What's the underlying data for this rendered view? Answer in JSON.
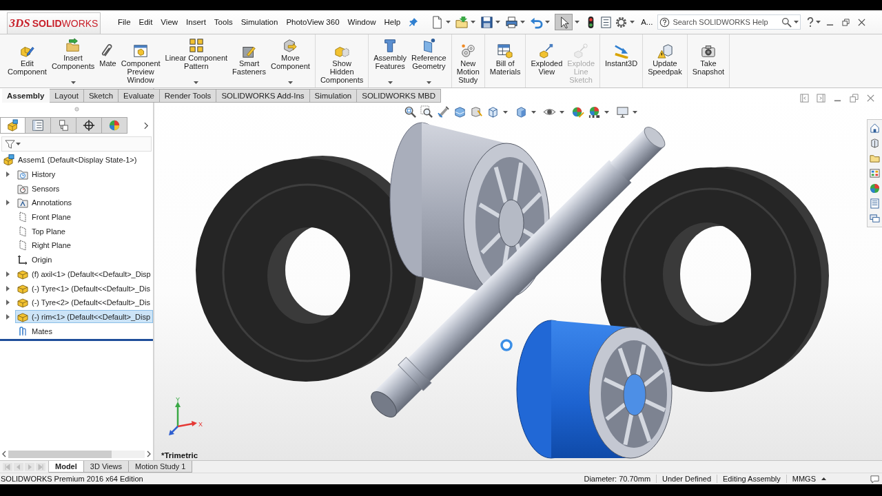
{
  "title_bar": {
    "logo_mark": "3DS",
    "logo": "**SOLID**WORKS",
    "menu": [
      "File",
      "Edit",
      "View",
      "Insert",
      "Tools",
      "Simulation",
      "PhotoView 360",
      "Window",
      "Help"
    ],
    "select_tool": {
      "selected": true
    },
    "overflow": "A...",
    "search": {
      "placeholder": "Search SOLIDWORKS Help"
    }
  },
  "ribbon": {
    "groups": [
      [
        {
          "label": "Edit\nComponent",
          "dropdown": false,
          "disabled": false
        },
        {
          "label": "Insert\nComponents",
          "dropdown": true,
          "disabled": false
        },
        {
          "label": "Mate",
          "dropdown": false,
          "disabled": false
        },
        {
          "label": "Component\nPreview\nWindow",
          "dropdown": false,
          "disabled": false
        },
        {
          "label": "Linear Component\nPattern",
          "dropdown": true,
          "disabled": false
        },
        {
          "label": "Smart\nFasteners",
          "dropdown": false,
          "disabled": false
        },
        {
          "label": "Move\nComponent",
          "dropdown": true,
          "disabled": false
        }
      ],
      [
        {
          "label": "Show\nHidden\nComponents",
          "dropdown": false,
          "disabled": false
        }
      ],
      [
        {
          "label": "Assembly\nFeatures",
          "dropdown": true,
          "disabled": false
        },
        {
          "label": "Reference\nGeometry",
          "dropdown": true,
          "disabled": false
        }
      ],
      [
        {
          "label": "New\nMotion\nStudy",
          "dropdown": false,
          "disabled": false
        }
      ],
      [
        {
          "label": "Bill of\nMaterials",
          "dropdown": false,
          "disabled": false
        }
      ],
      [
        {
          "label": "Exploded\nView",
          "dropdown": false,
          "disabled": false
        },
        {
          "label": "Explode\nLine\nSketch",
          "dropdown": false,
          "disabled": true
        }
      ],
      [
        {
          "label": "Instant3D",
          "dropdown": false,
          "disabled": false
        }
      ],
      [
        {
          "label": "Update\nSpeedpak",
          "dropdown": false,
          "disabled": false
        }
      ],
      [
        {
          "label": "Take\nSnapshot",
          "dropdown": false,
          "disabled": false
        }
      ]
    ]
  },
  "command_tabs": [
    {
      "label": "Assembly",
      "selected": true
    },
    {
      "label": "Layout",
      "selected": false
    },
    {
      "label": "Sketch",
      "selected": false
    },
    {
      "label": "Evaluate",
      "selected": false
    },
    {
      "label": "Render Tools",
      "selected": false
    },
    {
      "label": "SOLIDWORKS Add-Ins",
      "selected": false
    },
    {
      "label": "Simulation",
      "selected": false
    },
    {
      "label": "SOLIDWORKS MBD",
      "selected": false
    }
  ],
  "feature_manager": {
    "panel_tabs": [
      {
        "selected": true
      },
      {
        "selected": false
      },
      {
        "selected": false
      },
      {
        "selected": false
      },
      {
        "selected": false
      }
    ],
    "tree": {
      "label": "Assem1 (Default<Display State-1>)",
      "kind": "assembly",
      "selected": false,
      "children": [
        {
          "label": "History",
          "kind": "history",
          "expandable": true,
          "selected": false
        },
        {
          "label": "Sensors",
          "kind": "sensors",
          "expandable": false,
          "selected": false
        },
        {
          "label": "Annotations",
          "kind": "annotations",
          "expandable": true,
          "selected": false
        },
        {
          "label": "Front Plane",
          "kind": "plane",
          "expandable": false,
          "selected": false
        },
        {
          "label": "Top Plane",
          "kind": "plane",
          "expandable": false,
          "selected": false
        },
        {
          "label": "Right Plane",
          "kind": "plane",
          "expandable": false,
          "selected": false
        },
        {
          "label": "Origin",
          "kind": "origin",
          "expandable": false,
          "selected": false
        },
        {
          "label": "(f) axil<1> (Default<<Default>_Disp",
          "kind": "part",
          "expandable": true,
          "selected": false
        },
        {
          "label": "(-) Tyre<1> (Default<<Default>_Dis",
          "kind": "part",
          "expandable": true,
          "selected": false
        },
        {
          "label": "(-) Tyre<2> (Default<<Default>_Dis",
          "kind": "part",
          "expandable": true,
          "selected": false
        },
        {
          "label": "(-) rim<1> (Default<<Default>_Disp",
          "kind": "part",
          "expandable": true,
          "selected": true
        },
        {
          "label": "Mates",
          "kind": "mates",
          "expandable": false,
          "selected": false
        }
      ]
    }
  },
  "graphics_area": {
    "view_name": "*Trimetric",
    "triad_labels": [
      "Y",
      "X"
    ]
  },
  "model_tabs": [
    {
      "label": "Model",
      "selected": true
    },
    {
      "label": "3D Views",
      "selected": false
    },
    {
      "label": "Motion Study 1",
      "selected": false
    }
  ],
  "status_bar": {
    "edition": "SOLIDWORKS Premium 2016 x64 Edition",
    "items": [
      "Diameter: 70.70mm",
      "Under Defined",
      "Editing Assembly",
      "MMGS"
    ]
  }
}
